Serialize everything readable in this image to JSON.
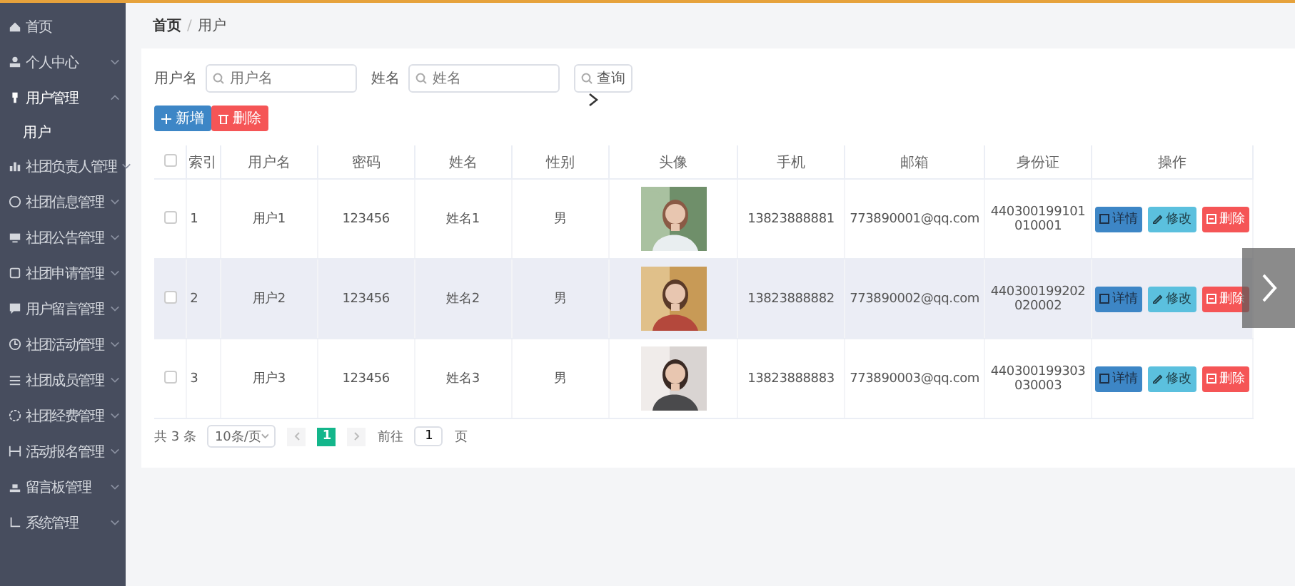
{
  "sidebar": {
    "items": [
      {
        "kind": "link",
        "label": "首页"
      },
      {
        "kind": "menu",
        "label": "个人中心",
        "expanded": false
      },
      {
        "kind": "menu",
        "label": "用户管理",
        "expanded": true,
        "children": [
          {
            "label": "用户"
          }
        ]
      },
      {
        "kind": "menu",
        "label": "社团负责人管理",
        "expanded": false
      },
      {
        "kind": "menu",
        "label": "社团信息管理",
        "expanded": false
      },
      {
        "kind": "menu",
        "label": "社团公告管理",
        "expanded": false
      },
      {
        "kind": "menu",
        "label": "社团申请管理",
        "expanded": false
      },
      {
        "kind": "menu",
        "label": "用户留言管理",
        "expanded": false
      },
      {
        "kind": "menu",
        "label": "社团活动管理",
        "expanded": false
      },
      {
        "kind": "menu",
        "label": "社团成员管理",
        "expanded": false
      },
      {
        "kind": "menu",
        "label": "社团经费管理",
        "expanded": false
      },
      {
        "kind": "menu",
        "label": "活动报名管理",
        "expanded": false
      },
      {
        "kind": "menu",
        "label": "留言板管理",
        "expanded": false
      },
      {
        "kind": "menu",
        "label": "系统管理",
        "expanded": false
      }
    ]
  },
  "breadcrumb": {
    "items": [
      "首页",
      "用户"
    ],
    "separator": "/"
  },
  "search": {
    "fields": [
      {
        "label": "用户名",
        "placeholder": "用户名"
      },
      {
        "label": "姓名",
        "placeholder": "姓名"
      }
    ],
    "button": "查询"
  },
  "actions": [
    {
      "kind": "add",
      "label": "新增"
    },
    {
      "kind": "delete",
      "label": "删除"
    }
  ],
  "table": {
    "all_checked": false,
    "columns": [
      "索引",
      "用户名",
      "密码",
      "姓名",
      "性别",
      "头像",
      "手机",
      "邮箱",
      "身份证",
      "操作"
    ],
    "rows": [
      {
        "checked": false,
        "hovered": false,
        "cells": [
          "1",
          "用户1",
          "123456",
          "姓名1",
          "男",
          {
            "kind": "picture"
          },
          "13823888881",
          "773890001@qq.com",
          "440300199101010001"
        ],
        "buttons": [
          {
            "kind": "detail",
            "label": "详情"
          },
          {
            "kind": "edit",
            "label": "修改"
          },
          {
            "kind": "delete",
            "label": "删除"
          }
        ]
      },
      {
        "checked": false,
        "hovered": true,
        "cells": [
          "2",
          "用户2",
          "123456",
          "姓名2",
          "男",
          {
            "kind": "picture"
          },
          "13823888882",
          "773890002@qq.com",
          "440300199202020002"
        ],
        "buttons": [
          {
            "kind": "detail",
            "label": "详情"
          },
          {
            "kind": "edit",
            "label": "修改"
          },
          {
            "kind": "delete",
            "label": "删除"
          }
        ]
      },
      {
        "checked": false,
        "hovered": false,
        "cells": [
          "3",
          "用户3",
          "123456",
          "姓名3",
          "男",
          {
            "kind": "picture"
          },
          "13823888883",
          "773890003@qq.com",
          "440300199303030003"
        ],
        "buttons": [
          {
            "kind": "detail",
            "label": "详情"
          },
          {
            "kind": "edit",
            "label": "修改"
          },
          {
            "kind": "delete",
            "label": "删除"
          }
        ]
      }
    ]
  },
  "pagination": {
    "total": "共 3 条",
    "page_size": "10条/页",
    "pages": [
      {
        "label": "1",
        "selected": true
      }
    ],
    "goto_label": "前往",
    "goto_value": "1",
    "goto_suffix": "页"
  }
}
